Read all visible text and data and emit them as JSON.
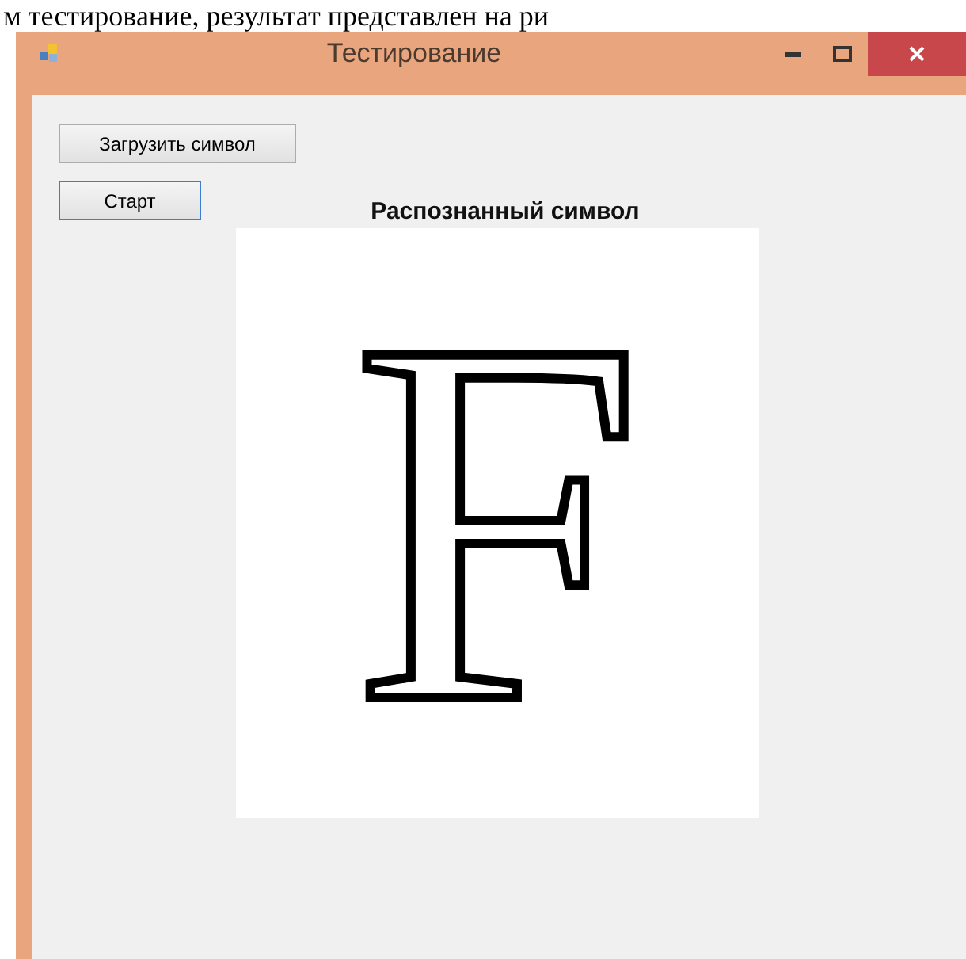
{
  "document_text": "м тестирование, результат представлен на ри",
  "window": {
    "title": "Тестирование"
  },
  "buttons": [
    {
      "label": "Загрузить символ",
      "focused": false
    },
    {
      "label": "Старт",
      "focused": true
    }
  ],
  "result_label": "Распознанный символ",
  "symbol_image": {
    "glyph": "F"
  }
}
